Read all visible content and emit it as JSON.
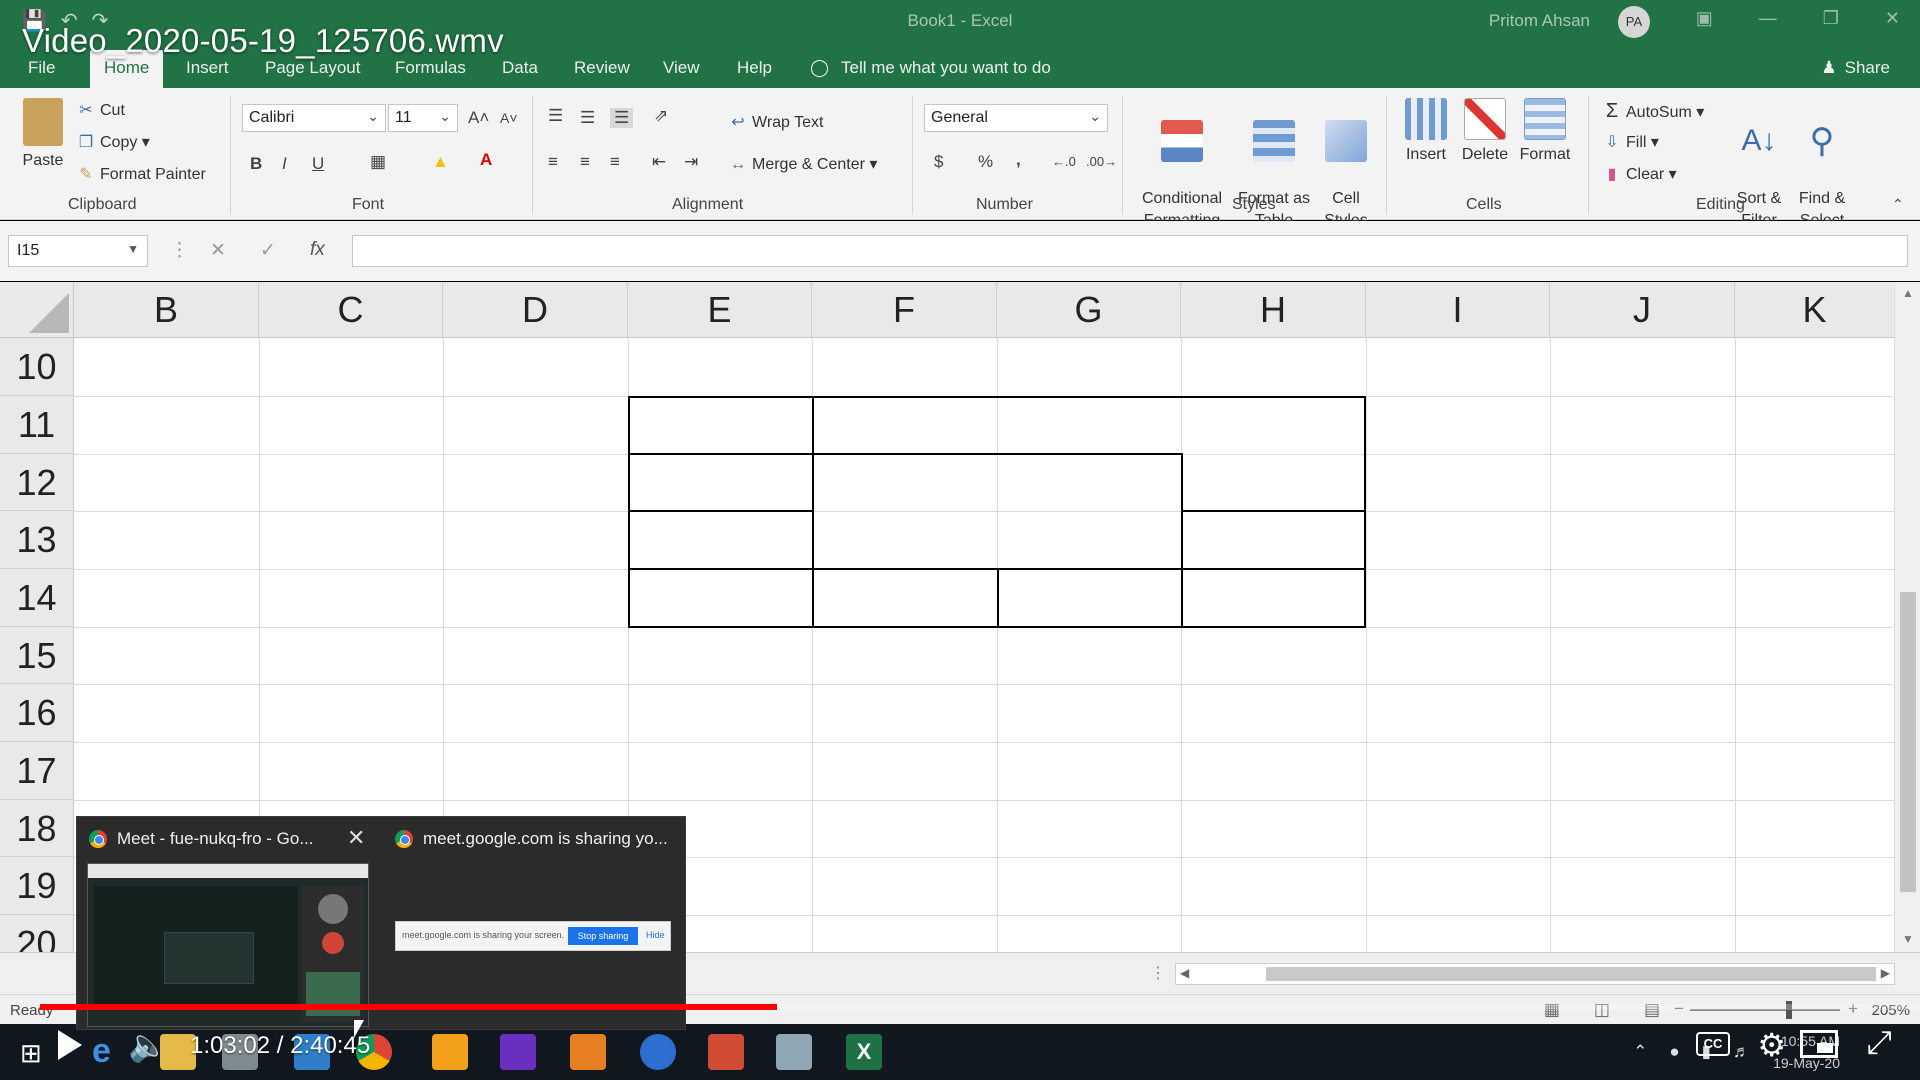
{
  "video": {
    "title": "Video_2020-05-19_125706.wmv",
    "current_time": "1:03:02",
    "duration": "2:40:45",
    "progress": 0.392,
    "cc_label": "CC"
  },
  "window": {
    "doc_title": "Book1  -  Excel",
    "user_name": "Pritom Ahsan",
    "user_initials": "PA"
  },
  "tabs": [
    "File",
    "Home",
    "Insert",
    "Page Layout",
    "Formulas",
    "Data",
    "Review",
    "View",
    "Help"
  ],
  "active_tab": "Home",
  "tell_me": "Tell me what you want to do",
  "share": "Share",
  "ribbon": {
    "clipboard": {
      "paste": "Paste",
      "cut": "Cut",
      "copy": "Copy",
      "format_painter": "Format Painter",
      "label": "Clipboard"
    },
    "font": {
      "name": "Calibri",
      "size": "11",
      "label": "Font",
      "bold": "B",
      "italic": "I",
      "underline": "U"
    },
    "alignment": {
      "wrap_text": "Wrap Text",
      "merge_center": "Merge & Center",
      "label": "Alignment"
    },
    "number": {
      "format": "General",
      "currency": "$",
      "percent": "%",
      "comma": ",",
      "label": "Number"
    },
    "styles": {
      "conditional": "Conditional\nFormatting",
      "format_table": "Format as\nTable",
      "cell_styles": "Cell\nStyles",
      "label": "Styles"
    },
    "cells": {
      "insert": "Insert",
      "delete": "Delete",
      "format": "Format",
      "label": "Cells"
    },
    "editing": {
      "autosum": "AutoSum",
      "fill": "Fill",
      "clear": "Clear",
      "sort_filter": "Sort &\nFilter",
      "find_select": "Find &\nSelect",
      "label": "Editing"
    }
  },
  "formula_bar": {
    "name_box": "I15",
    "fx": "fx",
    "value": ""
  },
  "columns": [
    "B",
    "C",
    "D",
    "E",
    "F",
    "G",
    "H",
    "I",
    "J",
    "K"
  ],
  "rows": [
    "10",
    "11",
    "12",
    "13",
    "14",
    "15",
    "16",
    "17",
    "18",
    "19",
    "20"
  ],
  "status": {
    "ready": "Ready",
    "zoom": "205%"
  },
  "popup": {
    "tab1": "Meet - fue-nukq-fro - Go...",
    "tab2": "meet.google.com is sharing yo...",
    "sharing_text": "meet.google.com is sharing your screen.",
    "stop_sharing": "Stop sharing",
    "hide": "Hide"
  },
  "clock": {
    "time": "10:55 AM",
    "date": "19-May-20"
  }
}
